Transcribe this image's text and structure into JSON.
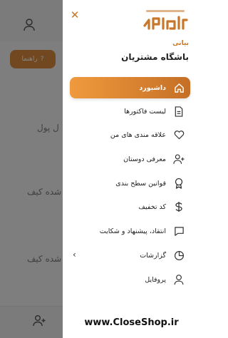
{
  "background": {
    "button_label": "راهنما",
    "text_1": "ل پول",
    "text_2": "شده کیف",
    "text_3": "شده کیف"
  },
  "drawer": {
    "brand_sub": "بیانی",
    "title": "باشگاه مشتریان",
    "items": [
      {
        "label": "داشبورد",
        "icon": "home-icon"
      },
      {
        "label": "لیست فاکتورها",
        "icon": "invoice-icon"
      },
      {
        "label": "علاقه مندی های من",
        "icon": "heart-icon"
      },
      {
        "label": "معرفی دوستان",
        "icon": "add-user-icon"
      },
      {
        "label": "قوانین سطح بندی",
        "icon": "badge-icon"
      },
      {
        "label": "کد تخفیف",
        "icon": "dollar-icon"
      },
      {
        "label": "انتقاد، پیشنهاد و شکایت",
        "icon": "message-icon"
      },
      {
        "label": "گزارشات",
        "icon": "pie-chart-icon"
      },
      {
        "label": "پروفایل",
        "icon": "user-icon"
      }
    ]
  },
  "footer": {
    "watermark": "www.CloseShop.ir"
  },
  "colors": {
    "accent": "#c8772a",
    "accent_light": "#f09a3e"
  }
}
